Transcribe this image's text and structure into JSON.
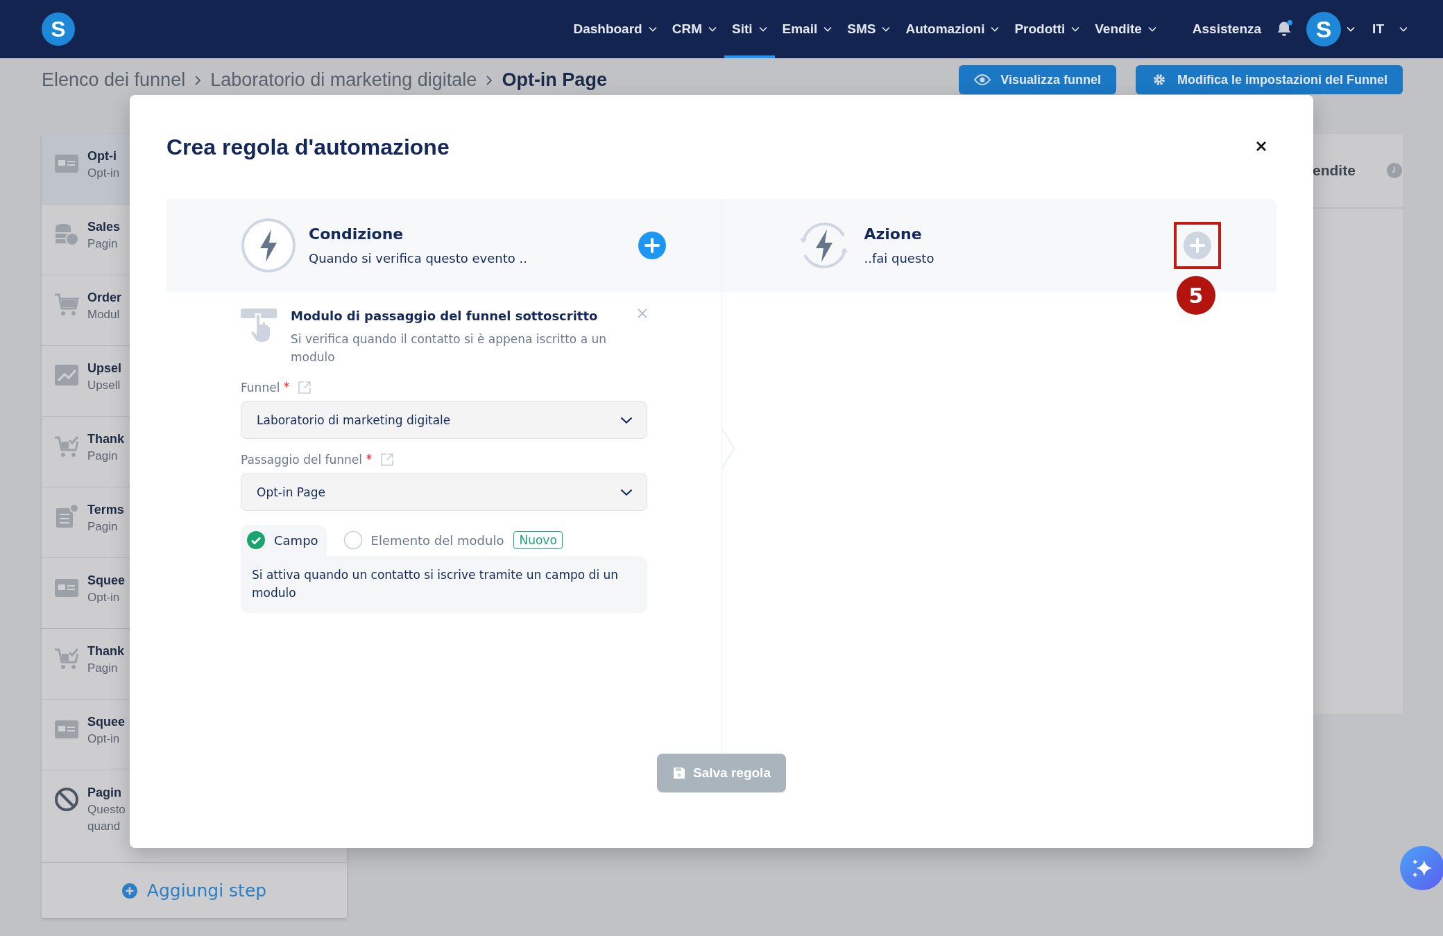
{
  "nav": {
    "logo": "S",
    "items": [
      {
        "label": "Dashboard",
        "selected": false
      },
      {
        "label": "CRM",
        "selected": false
      },
      {
        "label": "Siti",
        "selected": true
      },
      {
        "label": "Email",
        "selected": false
      },
      {
        "label": "SMS",
        "selected": false
      },
      {
        "label": "Automazioni",
        "selected": false
      },
      {
        "label": "Prodotti",
        "selected": false
      },
      {
        "label": "Vendite",
        "selected": false
      }
    ],
    "help": "Assistenza",
    "notification": true,
    "avatar": "S",
    "language": "IT"
  },
  "breadcrumb": [
    "Elenco dei funnel",
    "Laboratorio di marketing digitale",
    "Opt-in Page"
  ],
  "header_buttons": [
    {
      "label": "Visualizza funnel",
      "kind": "view"
    },
    {
      "label": "Modifica le impostazioni del Funnel",
      "kind": "settings"
    }
  ],
  "sidebar": {
    "steps": [
      {
        "kind": "form",
        "title": "Opt-i",
        "subtitle": [
          "Opt-in"
        ],
        "selected": true
      },
      {
        "kind": "coins",
        "title": "Sales",
        "subtitle": [
          "Pagin"
        ],
        "selected": false
      },
      {
        "kind": "cart",
        "title": "Order",
        "subtitle": [
          "Modul"
        ],
        "selected": false
      },
      {
        "kind": "chart",
        "title": "Upsel",
        "subtitle": [
          "Upsell"
        ],
        "selected": false
      },
      {
        "kind": "cart-check",
        "title": "Thank",
        "subtitle": [
          "Pagin"
        ],
        "selected": false
      },
      {
        "kind": "doc",
        "title": "Terms",
        "subtitle": [
          "Pagin"
        ],
        "selected": false
      },
      {
        "kind": "form",
        "title": "Squee",
        "subtitle": [
          "Opt-in"
        ],
        "selected": false
      },
      {
        "kind": "cart-check",
        "title": "Thank",
        "subtitle": [
          "Pagin"
        ],
        "selected": false
      },
      {
        "kind": "form",
        "title": "Squee",
        "subtitle": [
          "Opt-in"
        ],
        "selected": false
      },
      {
        "kind": "ban",
        "title": "Pagin",
        "subtitle": [
          "Questo",
          "quand"
        ],
        "selected": false
      }
    ],
    "add_step": "Aggiungi step"
  },
  "right_panel": {
    "tab": "endite"
  },
  "modal": {
    "title": "Crea regola d'automazione",
    "condition": {
      "title": "Condizione",
      "subtitle": "Quando si verifica questo evento .."
    },
    "action": {
      "title": "Azione",
      "subtitle": "..fai questo",
      "highlighted": true,
      "marker": "5"
    },
    "trigger": {
      "title": "Modulo di passaggio del funnel sottoscritto",
      "description": "Si verifica quando il contatto si è appena iscritto a un modulo",
      "fields": [
        {
          "label": "Funnel",
          "required": true,
          "value": "Laboratorio di marketing digitale"
        },
        {
          "label": "Passaggio del funnel",
          "required": true,
          "value": "Opt-in Page"
        }
      ],
      "options": [
        {
          "label": "Campo",
          "selected": true
        },
        {
          "label": "Elemento del modulo",
          "selected": false,
          "badge": "Nuovo"
        }
      ],
      "option_description": "Si attiva quando un contatto si iscrive tramite un campo di un modulo"
    },
    "save_button": {
      "label": "Salva regola",
      "disabled": true
    }
  }
}
